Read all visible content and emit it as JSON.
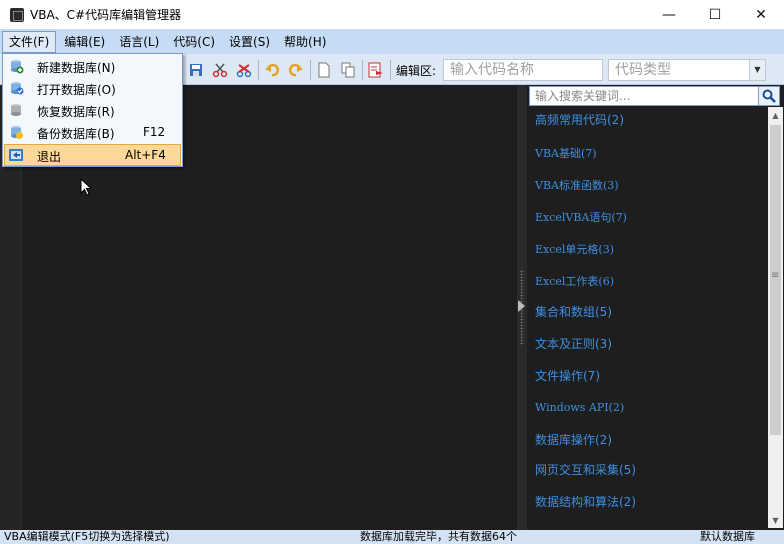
{
  "window": {
    "title": "VBA、C#代码库编辑管理器",
    "minimize": "—",
    "maximize": "☐",
    "close": "✕"
  },
  "menubar": {
    "items": [
      {
        "label": "文件(F)"
      },
      {
        "label": "编辑(E)"
      },
      {
        "label": "语言(L)"
      },
      {
        "label": "代码(C)"
      },
      {
        "label": "设置(S)"
      },
      {
        "label": "帮助(H)"
      }
    ]
  },
  "toolbar": {
    "edit_area_label": "编辑区:",
    "code_name_placeholder": "输入代码名称",
    "code_type_placeholder": "代码类型"
  },
  "file_menu": {
    "items": [
      {
        "label": "新建数据库(N)",
        "shortcut": ""
      },
      {
        "label": "打开数据库(O)",
        "shortcut": ""
      },
      {
        "label": "恢复数据库(R)",
        "shortcut": ""
      },
      {
        "label": "备份数据库(B)",
        "shortcut": "F12"
      },
      {
        "label": "退出",
        "shortcut": "Alt+F4"
      }
    ]
  },
  "right_panel": {
    "search_placeholder": "输入搜索关键词...",
    "tree": [
      {
        "label": "高频常用代码(2)"
      },
      {
        "label": "VBA基础(7)"
      },
      {
        "label": "VBA标准函数(3)"
      },
      {
        "label": "ExcelVBA语句(7)"
      },
      {
        "label": "Excel单元格(3)"
      },
      {
        "label": "Excel工作表(6)"
      },
      {
        "label": "集合和数组(5)"
      },
      {
        "label": "文本及正则(3)"
      },
      {
        "label": "文件操作(7)"
      },
      {
        "label": "Windows API(2)"
      },
      {
        "label": "数据库操作(2)"
      },
      {
        "label": "网页交互和采集(5)"
      },
      {
        "label": "数据结构和算法(2)"
      }
    ]
  },
  "statusbar": {
    "mode": "VBA编辑模式(F5切换为选择模式)",
    "load_status": "数据库加载完毕，共有数据64个",
    "database": "默认数据库"
  },
  "colors": {
    "menubar_bg": "#c6dcf5",
    "toolbar_bg": "#dde8f5",
    "editor_bg": "#1e1e1e",
    "tree_link": "#3f8fe0",
    "menu_hover": "#fcd999"
  }
}
